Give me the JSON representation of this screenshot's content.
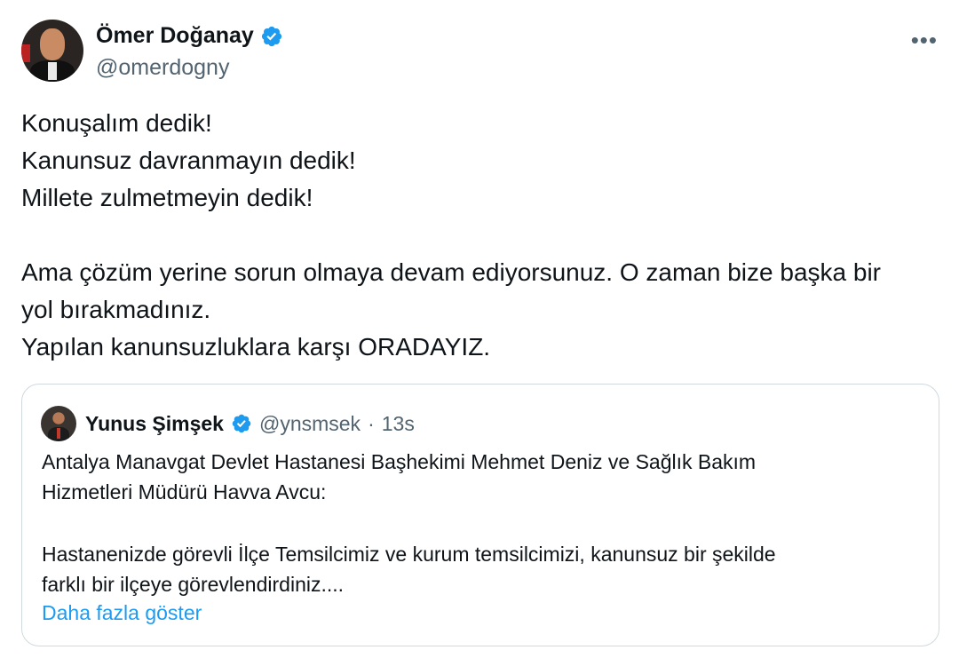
{
  "author": {
    "name": "Ömer Doğanay",
    "handle": "@omerdogny"
  },
  "more_label": "•••",
  "tweet": {
    "lines_block1": [
      "Konuşalım dedik!",
      "Kanunsuz davranmayın dedik!",
      "Millete zulmetmeyin dedik!"
    ],
    "lines_block2": [
      "Ama çözüm yerine sorun olmaya devam ediyorsunuz. O zaman bize başka bir",
      "yol bırakmadınız.",
      "Yapılan kanunsuzluklara karşı ORADAYIZ."
    ]
  },
  "quote": {
    "name": "Yunus Şimşek",
    "handle": "@ynsmsek",
    "dot": "·",
    "time": "13s",
    "para1": [
      "Antalya Manavgat Devlet Hastanesi Başhekimi Mehmet Deniz ve Sağlık Bakım",
      "Hizmetleri Müdürü Havva Avcu:"
    ],
    "para2": [
      "Hastanenizde görevli İlçe Temsilcimiz ve kurum temsilcimizi, kanunsuz bir şekilde",
      "farklı bir ilçeye görevlendirdiniz...."
    ],
    "show_more": "Daha fazla göster"
  },
  "colors": {
    "verified": "#1d9bf0",
    "link": "#1d9bf0",
    "secondary_text": "#536471",
    "border": "#cfd9de"
  },
  "icons": {
    "verified": "verified-badge-icon",
    "more": "more-horizontal-icon"
  }
}
